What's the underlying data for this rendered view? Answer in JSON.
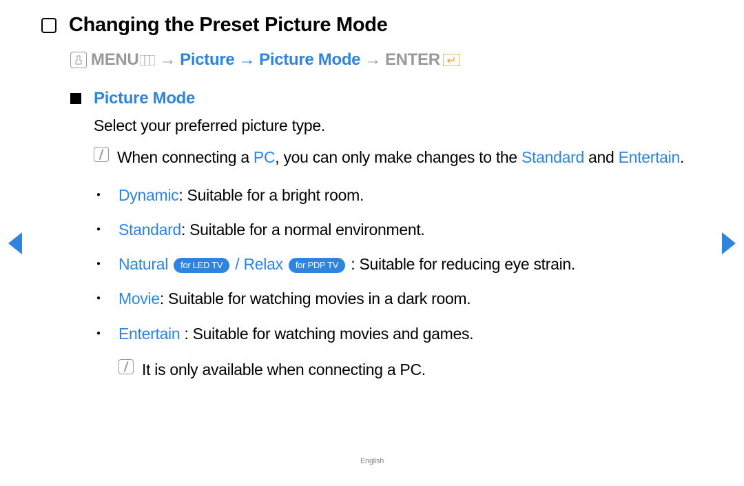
{
  "title": "Changing the Preset Picture Mode",
  "navPath": {
    "menu": "MENU",
    "step1": "Picture",
    "step2": "Picture Mode",
    "enter": "ENTER",
    "arrow": "→"
  },
  "section": {
    "title": "Picture Mode",
    "description": "Select your preferred picture type."
  },
  "note1": {
    "prefix": "When connecting a ",
    "pc": "PC",
    "mid": ", you can only make changes to the ",
    "standard": "Standard",
    "and": " and ",
    "entertain": "Entertain",
    "suffix": "."
  },
  "bullets": {
    "dynamic": {
      "label": "Dynamic",
      "desc": ": Suitable for a bright room."
    },
    "standard": {
      "label": "Standard",
      "desc": ": Suitable for a normal environment."
    },
    "natural": {
      "label": "Natural",
      "badge1": "for LED TV",
      "sep": " / ",
      "relax": "Relax",
      "badge2": "for PDP TV",
      "desc": ": Suitable for reducing eye strain."
    },
    "movie": {
      "label": "Movie",
      "desc": ": Suitable for watching movies in a dark room."
    },
    "entertain": {
      "label": "Entertain ",
      "desc": ": Suitable for watching movies and games."
    }
  },
  "note2": "It is only available when connecting a PC.",
  "footer": "English"
}
